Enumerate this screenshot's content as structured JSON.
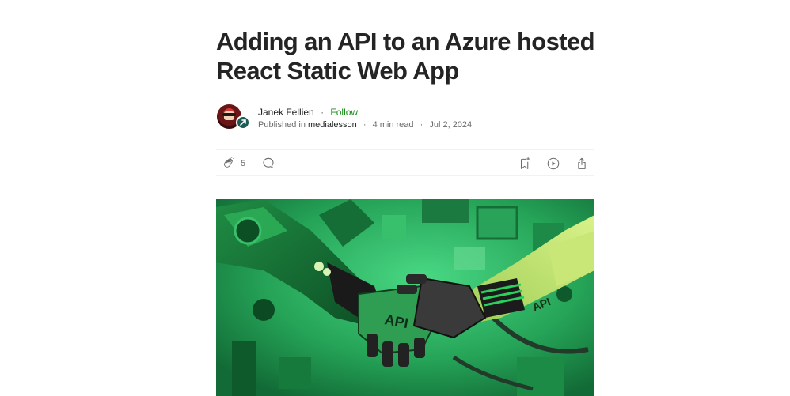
{
  "article": {
    "title": "Adding an API to an Azure hosted React Static Web App"
  },
  "byline": {
    "author_name": "Janek Fellien",
    "separator": "·",
    "follow_label": "Follow",
    "published_in_label": "Published in",
    "publication_name": "medialesson",
    "read_time": "4 min read",
    "date": "Jul 2, 2024"
  },
  "actions": {
    "clap_count": "5"
  },
  "hero_image": {
    "text_api_center": "API",
    "text_api_right": "API"
  },
  "icons": {
    "clap": "clap-icon",
    "comment": "comment-icon",
    "save": "bookmark-icon",
    "listen": "play-icon",
    "share": "share-icon"
  },
  "colors": {
    "text": "#242424",
    "muted": "#6b6b6b",
    "follow": "#1a8917",
    "divider": "#f2f2f2",
    "hero_green": "#27a65a"
  }
}
